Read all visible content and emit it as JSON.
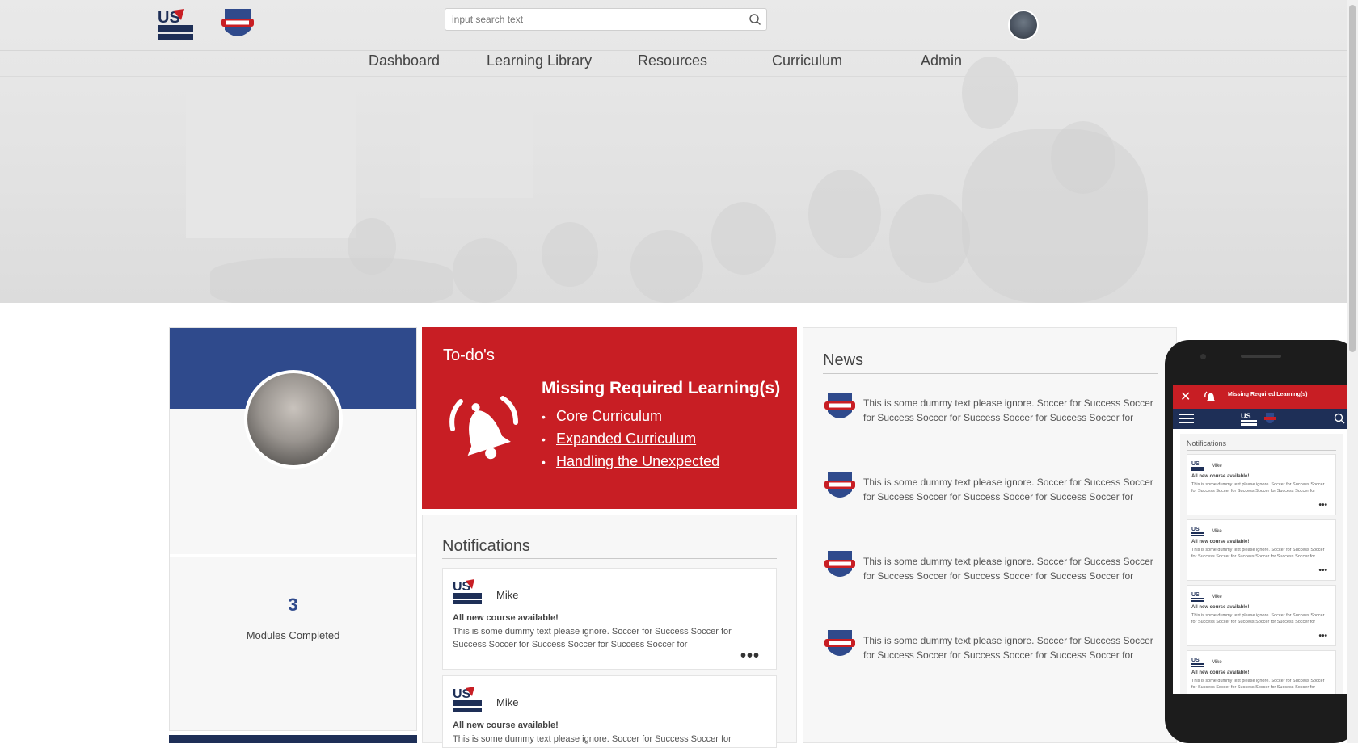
{
  "header": {
    "search_placeholder": "input search text",
    "logos": [
      "us-soccer-foundation-logo",
      "soccer-for-success-logo"
    ],
    "nav": [
      {
        "label": "Dashboard"
      },
      {
        "label": "Learning Library"
      },
      {
        "label": "Resources"
      },
      {
        "label": "Curriculum"
      },
      {
        "label": "Admin"
      }
    ]
  },
  "profile": {
    "modules_completed": "3",
    "modules_label": "Modules Completed"
  },
  "todo": {
    "title": "To-do's",
    "heading": "Missing Required Learning(s)",
    "items": [
      "Core Curriculum",
      "Expanded Curriculum",
      "Handling the Unexpected"
    ]
  },
  "notifications": {
    "title": "Notifications",
    "items": [
      {
        "name": "Mike",
        "title": "All new course available!",
        "body": "This is some dummy text please ignore. Soccer for Success Soccer for Success Soccer for Success Soccer for Success Soccer for"
      },
      {
        "name": "Mike",
        "title": "All new course available!",
        "body": "This is some dummy text please ignore. Soccer for Success Soccer for"
      }
    ]
  },
  "news": {
    "title": "News",
    "items": [
      {
        "text": "This is some dummy text please ignore. Soccer for Success Soccer for Success Soccer for Success Soccer for Success Soccer for"
      },
      {
        "text": "This is some dummy text please ignore. Soccer for Success Soccer for Success Soccer for Success Soccer for Success Soccer for"
      },
      {
        "text": "This is some dummy text please ignore. Soccer for Success Soccer for Success Soccer for Success Soccer for Success Soccer for"
      },
      {
        "text": "This is some dummy text please ignore. Soccer for Success Soccer for Success Soccer for Success Soccer for Success Soccer for"
      }
    ]
  },
  "mobile": {
    "alert_text": "Missing Required Learning(s)",
    "close_glyph": "✕",
    "notifications_title": "Notifications",
    "items": [
      {
        "name": "Mike",
        "title": "All new course available!",
        "body": "This is some dummy text please ignore. Soccer for Success Soccer for Success Soccer for Success Soccer for Success Soccer for"
      },
      {
        "name": "Mike",
        "title": "All new course available!",
        "body": "This is some dummy text please ignore. Soccer for Success Soccer for Success Soccer for Success Soccer for Success Soccer for"
      },
      {
        "name": "Mike",
        "title": "All new course available!",
        "body": "This is some dummy text please ignore. Soccer for Success Soccer for Success Soccer for Success Soccer for Success Soccer for"
      },
      {
        "name": "Mike",
        "title": "All new course available!",
        "body": "This is some dummy text please ignore. Soccer for Success Soccer for Success Soccer for Success Soccer for Success Soccer for"
      }
    ]
  },
  "menu_glyph": "•••",
  "colors": {
    "brand_blue": "#2f4a8c",
    "brand_navy": "#1e2f57",
    "brand_red": "#c81e24"
  }
}
